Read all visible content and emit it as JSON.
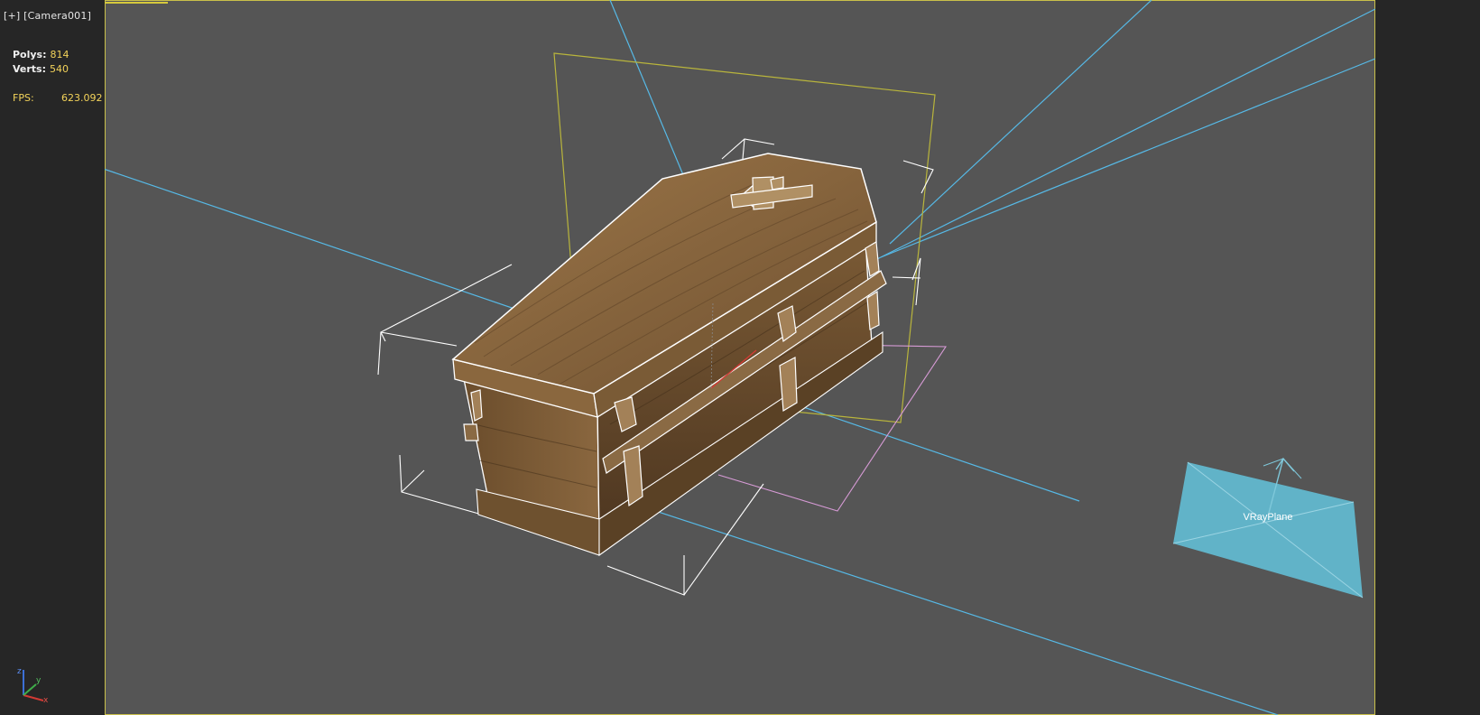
{
  "viewport": {
    "menu_label": "[+]",
    "camera_label": "[Camera001]"
  },
  "stats": {
    "polys_label": "Polys:",
    "polys_value": "814",
    "verts_label": "Verts:",
    "verts_value": "540",
    "fps_label": "FPS:",
    "fps_value": "623.092"
  },
  "scene": {
    "plane_label": "VRayPlane",
    "axis_z": "z",
    "axis_y": "y",
    "axis_x": "x"
  },
  "colors": {
    "viewport_bg": "#555555",
    "frame_bg": "#1f1f1f",
    "border_active": "#c9c04a",
    "light_line": "#56b9e6",
    "plane_fill": "#62b8cf",
    "wood_light": "#8e6a40",
    "wood_dark": "#5c4226",
    "selection_white": "#ffffff",
    "stat_value": "#f3d35a"
  }
}
